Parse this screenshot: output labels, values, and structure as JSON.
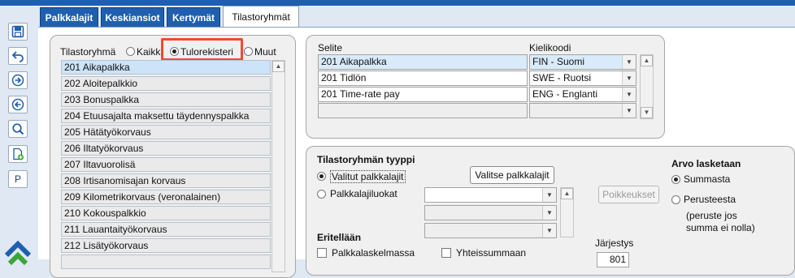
{
  "tabs": [
    {
      "label": "Palkkalajit"
    },
    {
      "label": "Keskiansiot"
    },
    {
      "label": "Kertymät"
    },
    {
      "label": "Tilastoryhmät"
    }
  ],
  "toolbar": {
    "p_label": "P"
  },
  "filter": {
    "label": "Tilastoryhmä",
    "options": [
      "Kaikki",
      "Tulorekisteri",
      "Muut"
    ],
    "selected": "Tulorekisteri"
  },
  "groups": [
    "201 Aikapalkka",
    "202 Aloitepalkkio",
    "203 Bonuspalkka",
    "204 Etuusajalta maksettu täydennyspalkka",
    "205 Hätätyökorvaus",
    "206 Iltatyökorvaus",
    "207 Iltavuorolisä",
    "208 Irtisanomisajan korvaus",
    "209 Kilometrikorvaus (veronalainen)",
    "210 Kokouspalkkio",
    "211 Lauantaityökorvaus",
    "212 Lisätyökorvaus"
  ],
  "translations": {
    "col_selite": "Selite",
    "col_kieli": "Kielikoodi",
    "rows": [
      {
        "selite": "201 Aikapalkka",
        "kieli": "FIN - Suomi"
      },
      {
        "selite": "201 Tidlön",
        "kieli": "SWE - Ruotsi"
      },
      {
        "selite": "201 Time-rate pay",
        "kieli": "ENG - Englanti"
      },
      {
        "selite": "",
        "kieli": ""
      }
    ]
  },
  "type_section": {
    "title": "Tilastoryhmän tyyppi",
    "opt_valitut": "Valitut palkkalajit",
    "opt_luokat": "Palkkalajiluokat",
    "btn_valitse": "Valitse palkkalajit",
    "btn_poikkeukset": "Poikkeukset",
    "arvo_title": "Arvo lasketaan",
    "arvo_summa": "Summasta",
    "arvo_peruste": "Perusteesta",
    "arvo_note": "(peruste jos summa ei nolla)",
    "eritellaan": "Eritellään",
    "chk_palkkalaskelma": "Palkkalaskelmassa",
    "chk_yhteis": "Yhteissummaan",
    "jarjestys_label": "Järjestys",
    "jarjestys_value": "801"
  }
}
